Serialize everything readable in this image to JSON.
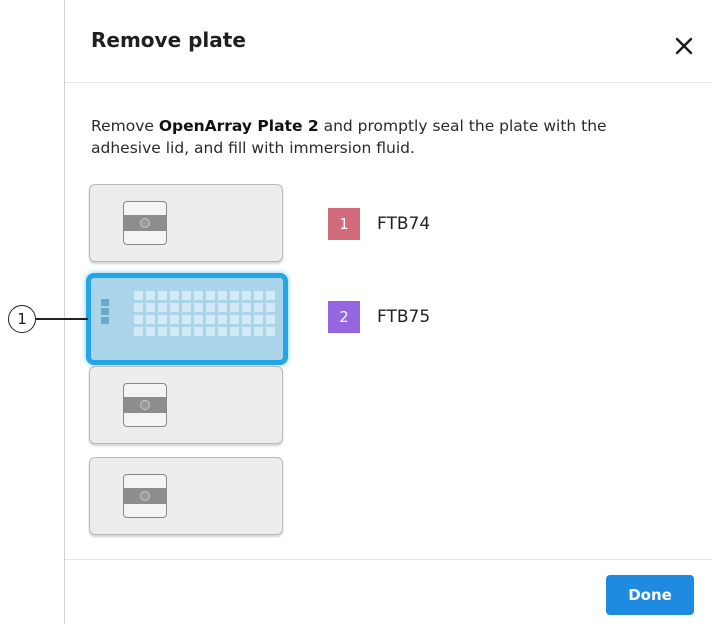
{
  "dialog": {
    "title": "Remove plate",
    "close_icon": "close-icon",
    "instruction": {
      "prefix": "Remove ",
      "plate_name": "OpenArray Plate 2",
      "suffix": " and promptly seal the plate with the adhesive lid, and fill with immersion fluid."
    },
    "done_label": "Done"
  },
  "slots": [
    {
      "position": 1,
      "state": "empty"
    },
    {
      "position": 2,
      "state": "selected-plate"
    },
    {
      "position": 3,
      "state": "empty"
    },
    {
      "position": 4,
      "state": "empty"
    }
  ],
  "callout": {
    "number": "1"
  },
  "legend": [
    {
      "number": "1",
      "name": "FTB74",
      "color": "#d16a7a"
    },
    {
      "number": "2",
      "name": "FTB75",
      "color": "#9466e0"
    }
  ],
  "colors": {
    "accent": "#1e8be0",
    "selected_border": "#24a6e6",
    "selected_fill": "#a9d4ea"
  }
}
